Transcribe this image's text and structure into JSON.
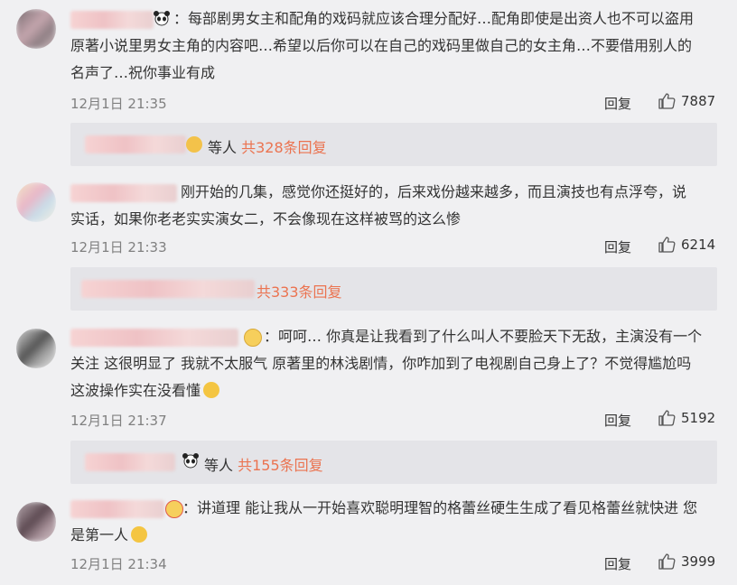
{
  "comments": [
    {
      "text_lines": [
        "：每部剧男女主和配角的戏码就应该合理分配好…配角即使是出资人也不可以盗用",
        "原著小说里男女主角的内容吧…希望以后你可以在自己的戏码里做自己的女主角…不要借用别人的",
        "名声了…祝你事业有成"
      ],
      "time": "12月1日 21:35",
      "reply_label": "回复",
      "likes": "7887",
      "reply_summary": {
        "suffix": "等人 ",
        "count": "共328条回复"
      }
    },
    {
      "text_lines": [
        "刚开始的几集，感觉你还挺好的，后来戏份越来越多，而且演技也有点浮夸，说",
        "实话，如果你老老实实演女二，不会像现在这样被骂的这么惨"
      ],
      "time": "12月1日 21:33",
      "reply_label": "回复",
      "likes": "6214",
      "reply_summary": {
        "suffix": "",
        "count": "共333条回复"
      }
    },
    {
      "text_lines": [
        "：呵呵… 你真是让我看到了什么叫人不要脸天下无敌，主演没有一个",
        "关注 这很明显了 我就不太服气 原著里的林浅剧情，你咋加到了电视剧自己身上了？不觉得尴尬吗",
        "这波操作实在没看懂"
      ],
      "time": "12月1日 21:37",
      "reply_label": "回复",
      "likes": "5192",
      "reply_summary": {
        "suffix": "等人 ",
        "count": "共155条回复"
      }
    },
    {
      "text_lines": [
        "：讲道理 能让我从一开始喜欢聪明理智的格蕾丝硬生生成了看见格蕾丝就快进 您",
        "是第一人"
      ],
      "time": "12月1日 21:34",
      "reply_label": "回复",
      "likes": "3999"
    }
  ],
  "icons": {
    "like": "thumbs-up-icon",
    "emoji": "emoji-icon",
    "panda": "panda-icon"
  },
  "colors": {
    "background": "#f0f0f2",
    "reply_box": "#e4e4e8",
    "reply_count": "#eb7350",
    "time": "#808080"
  }
}
